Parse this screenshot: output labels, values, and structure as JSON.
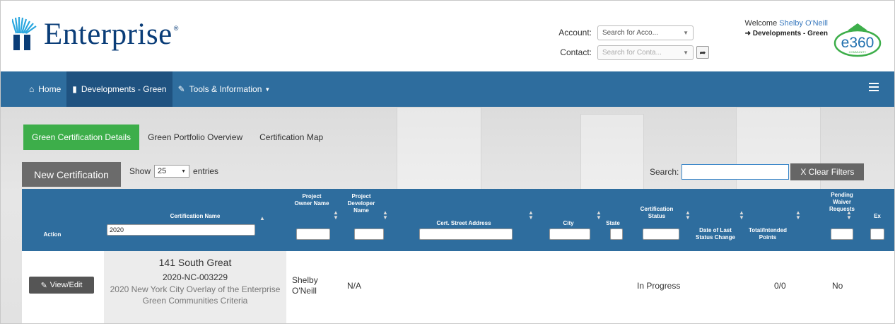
{
  "header": {
    "logo_text": "Enterprise",
    "account_label": "Account:",
    "account_placeholder": "Search for Acco...",
    "contact_label": "Contact:",
    "contact_placeholder": "Search for Conta...",
    "welcome_prefix": "Welcome ",
    "user_name": "Shelby O'Neill",
    "developments_link": "Developments - Green",
    "badge_text": "e360",
    "badge_sub": "COMMUNITY"
  },
  "nav": {
    "items": [
      {
        "label": "Home",
        "icon": "home-icon"
      },
      {
        "label": "Developments - Green",
        "icon": "building-icon"
      },
      {
        "label": "Tools & Information",
        "icon": "wrench-icon"
      }
    ],
    "menu_icon": "hamburger-icon"
  },
  "tabs": [
    "Green Certification Details",
    "Green Portfolio Overview",
    "Certification Map"
  ],
  "controls": {
    "new_cert": "New Certification",
    "show": "Show",
    "entries_value": "25",
    "entries": "entries",
    "search_label": "Search:",
    "clear_filters": "X Clear Filters"
  },
  "table": {
    "headers": {
      "action": "Action",
      "cert_name": "Certification Name",
      "owner": "Project Owner Name",
      "developer": "Project Developer Name",
      "street": "Cert. Street Address",
      "city": "City",
      "state": "State",
      "status": "Certification Status",
      "date": "Date of Last Status Change",
      "points": "Total/Intended Points",
      "waiver": "Pending Waiver Requests",
      "exp": "Ex"
    },
    "filter_cert_name": "2020",
    "row": {
      "action": "View/Edit",
      "project": "141 South Great",
      "cert_id": "2020-NC-003229",
      "criteria": "2020 New York City Overlay of the Enterprise Green Communities Criteria",
      "owner": "Shelby O'Neill",
      "developer": "N/A",
      "status": "In Progress",
      "points": "0/0",
      "waiver": "No"
    }
  }
}
